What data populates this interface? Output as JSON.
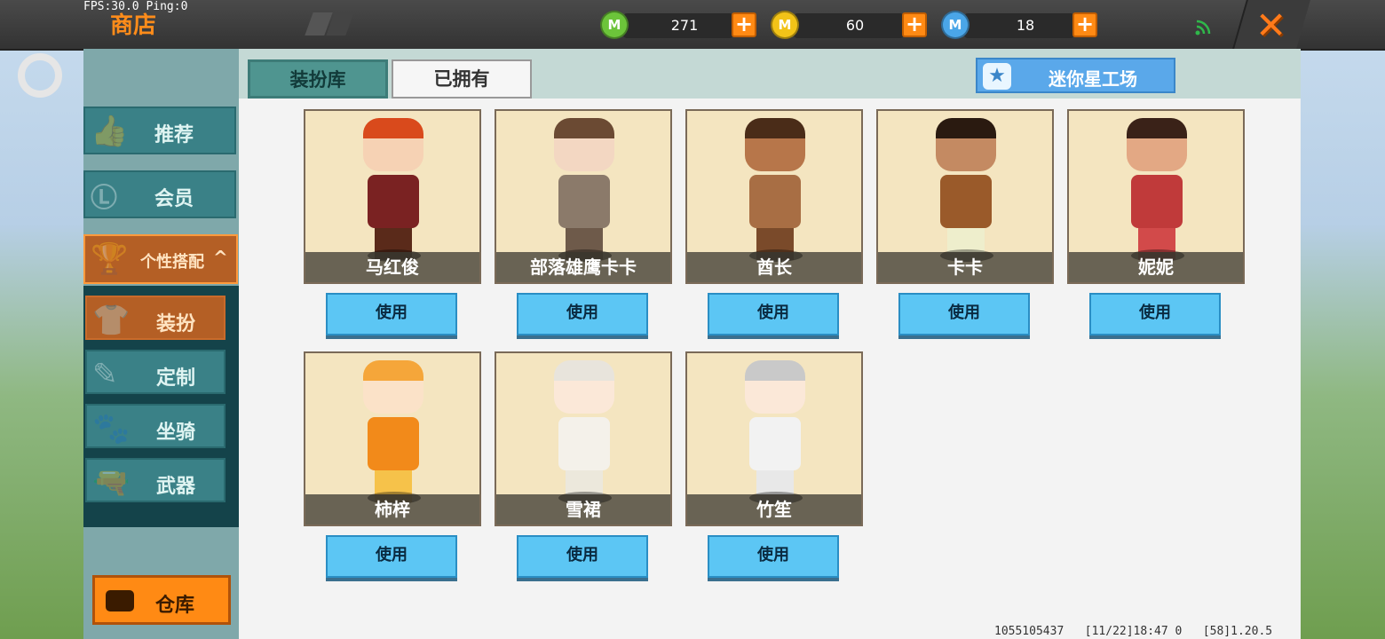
{
  "status": {
    "fps_text": "FPS:30.0  Ping:0"
  },
  "header": {
    "title": "商店",
    "currencies": [
      {
        "icon": "green-gem-icon",
        "color": "#6cc43a",
        "value": "271"
      },
      {
        "icon": "gold-coin-icon",
        "color": "#f2c318",
        "value": "60"
      },
      {
        "icon": "blue-m-coin-icon",
        "color": "#4aa6e8",
        "value": "18"
      }
    ],
    "coin_letter": "M"
  },
  "sidebar": {
    "categories": [
      {
        "label": "推荐",
        "icon": "thumbs-up-icon"
      },
      {
        "label": "会员",
        "icon": "vip-icon"
      },
      {
        "label": "个性搭配",
        "icon": "trophy-icon",
        "expanded": true,
        "arrow": "^"
      }
    ],
    "subcategories": [
      {
        "label": "装扮",
        "icon": "shirt-icon",
        "active": true
      },
      {
        "label": "定制",
        "icon": "pencil-ruler-icon"
      },
      {
        "label": "坐骑",
        "icon": "mount-icon"
      },
      {
        "label": "武器",
        "icon": "revolver-icon"
      }
    ],
    "warehouse_label": "仓库"
  },
  "tabs": {
    "wardrobe": "装扮库",
    "owned": "已拥有",
    "selected": "装扮库"
  },
  "workshop_label": "迷你星工场",
  "use_label": "使用",
  "items": [
    {
      "name": "马红俊",
      "hair": "#d94a1c",
      "skin": "#f6d2b4",
      "outfit": "#7a2222",
      "legs": "#5a2a1a"
    },
    {
      "name": "部落雄鹰卡卡",
      "hair": "#6b4a33",
      "skin": "#f3d7c2",
      "outfit": "#8b7a6a",
      "legs": "#6e5a4a"
    },
    {
      "name": "酋长",
      "hair": "#4a2c18",
      "skin": "#b7764a",
      "outfit": "#a86e44",
      "legs": "#7a4a2a"
    },
    {
      "name": "卡卡",
      "hair": "#2a1a10",
      "skin": "#c48a62",
      "outfit": "#9a5a2a",
      "legs": "#eeeecc"
    },
    {
      "name": "妮妮",
      "hair": "#3a2218",
      "skin": "#e3a884",
      "outfit": "#c03a3a",
      "legs": "#d24a4a"
    },
    {
      "name": "柿梓",
      "hair": "#f5a63a",
      "skin": "#fbe2c8",
      "outfit": "#f28a1a",
      "legs": "#f6c24a"
    },
    {
      "name": "雪裙",
      "hair": "#e8e4dc",
      "skin": "#fbe8d8",
      "outfit": "#f4f1ea",
      "legs": "#ece8dc"
    },
    {
      "name": "竹笙",
      "hair": "#c9c9c9",
      "skin": "#fbe8d8",
      "outfit": "#f2f2f2",
      "legs": "#e8e8e8"
    }
  ],
  "footer": {
    "uid": "1055105437",
    "time": "[11/22]18:47 0",
    "version": "[58]1.20.5"
  }
}
